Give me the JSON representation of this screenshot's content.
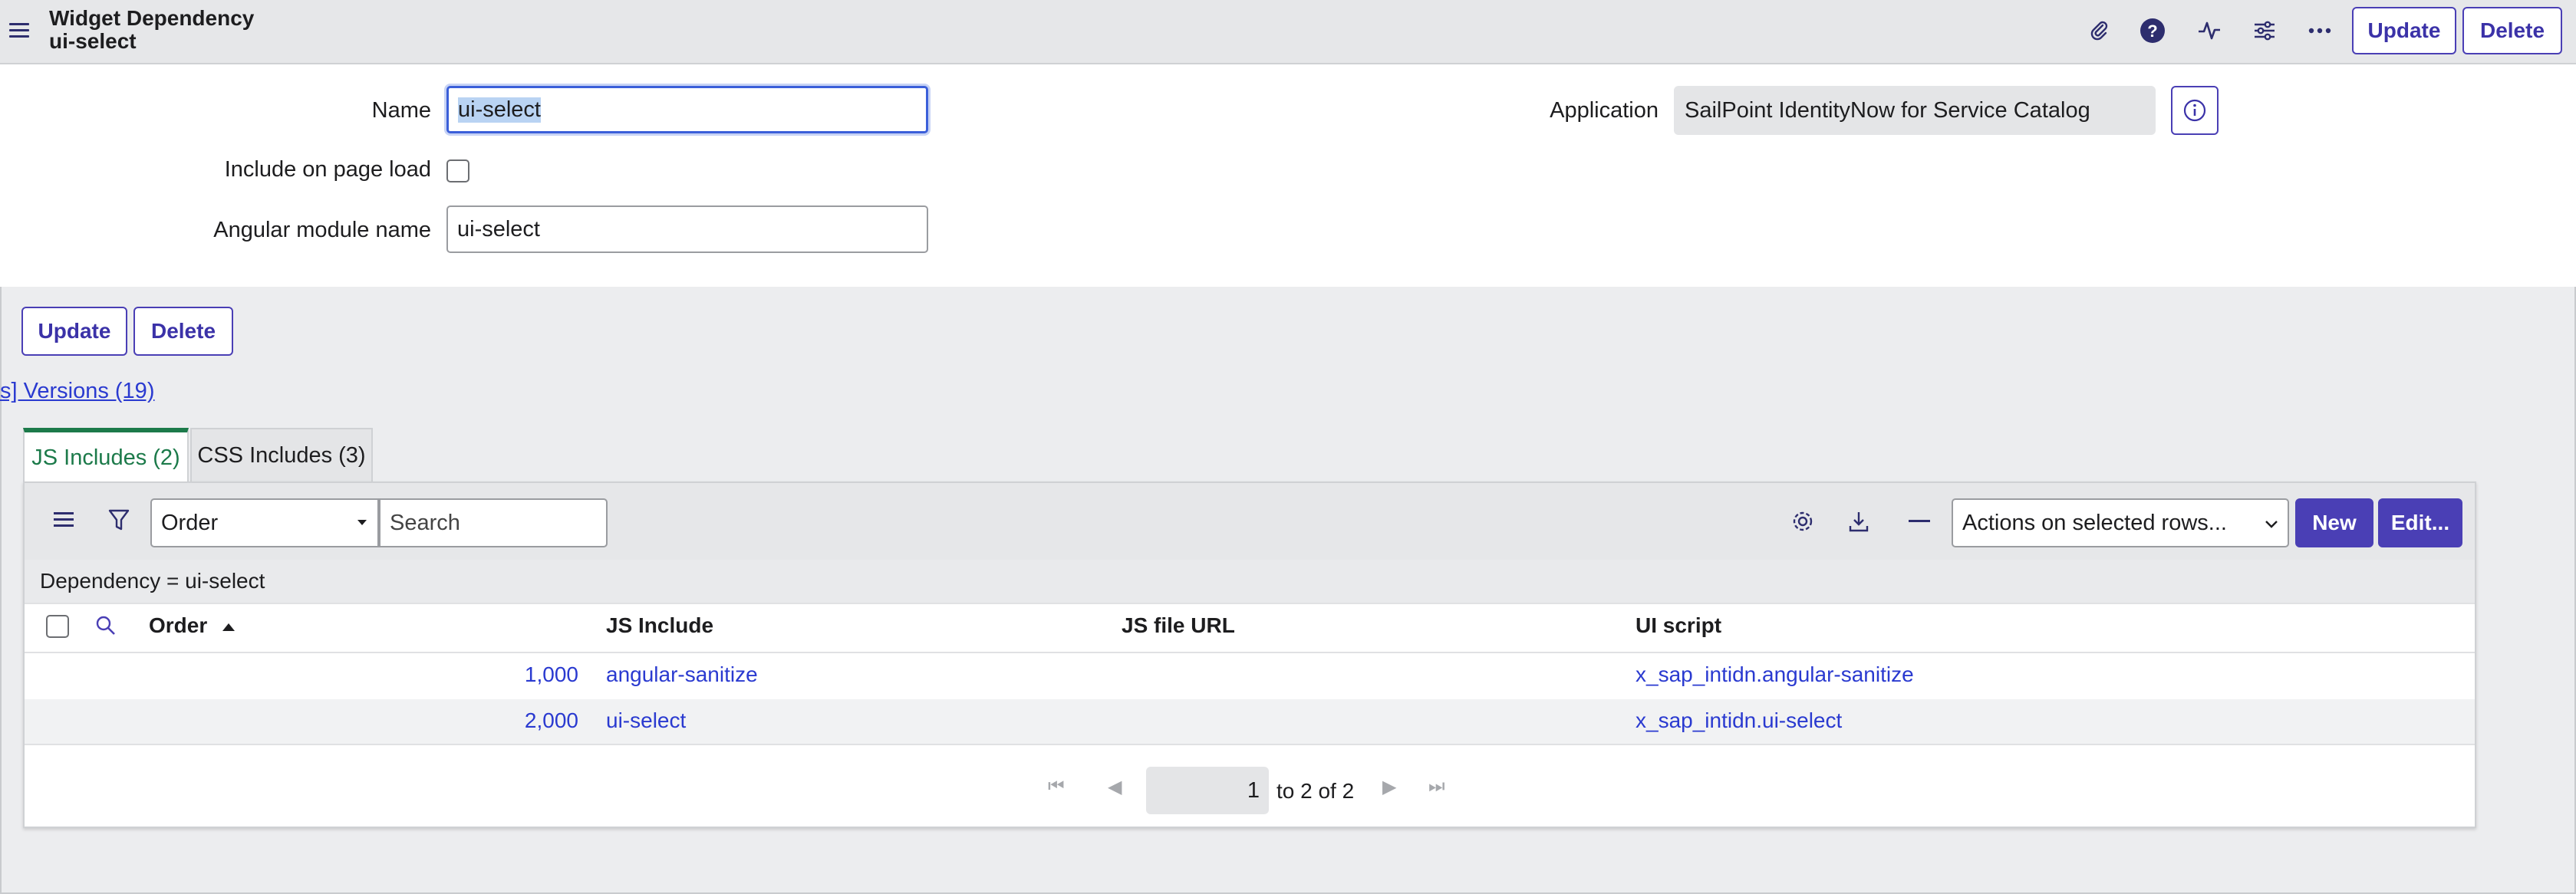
{
  "header": {
    "title_line1": "Widget Dependency",
    "title_line2": "ui-select",
    "update_label": "Update",
    "delete_label": "Delete"
  },
  "form": {
    "name_label": "Name",
    "name_value": "ui-select",
    "include_label": "Include on page load",
    "angular_label": "Angular module name",
    "angular_value": "ui-select",
    "application_label": "Application",
    "application_value": "SailPoint IdentityNow for Service Catalog"
  },
  "actions": {
    "update_label": "Update",
    "delete_label": "Delete"
  },
  "related": {
    "versions_link": "s] Versions (19)"
  },
  "tabs": [
    {
      "label": "JS Includes (2)",
      "active": true
    },
    {
      "label": "CSS Includes (3)",
      "active": false
    }
  ],
  "list": {
    "filter_field": "Order",
    "search_placeholder": "Search",
    "actions_select": "Actions on selected rows...",
    "new_label": "New",
    "edit_label": "Edit...",
    "condition": "Dependency = ui-select",
    "columns": [
      "Order",
      "JS Include",
      "JS file URL",
      "UI script"
    ],
    "rows": [
      {
        "order": "1,000",
        "js_include": "angular-sanitize",
        "url": "",
        "ui_script": "x_sap_intidn.angular-sanitize"
      },
      {
        "order": "2,000",
        "js_include": "ui-select",
        "url": "",
        "ui_script": "x_sap_intidn.ui-select"
      }
    ],
    "pager": {
      "current": "1",
      "range_text": "to 2 of 2"
    }
  },
  "colors": {
    "accent": "#4a3fb5",
    "active_tab": "#1c7a4a",
    "link": "#2a3ad0"
  }
}
